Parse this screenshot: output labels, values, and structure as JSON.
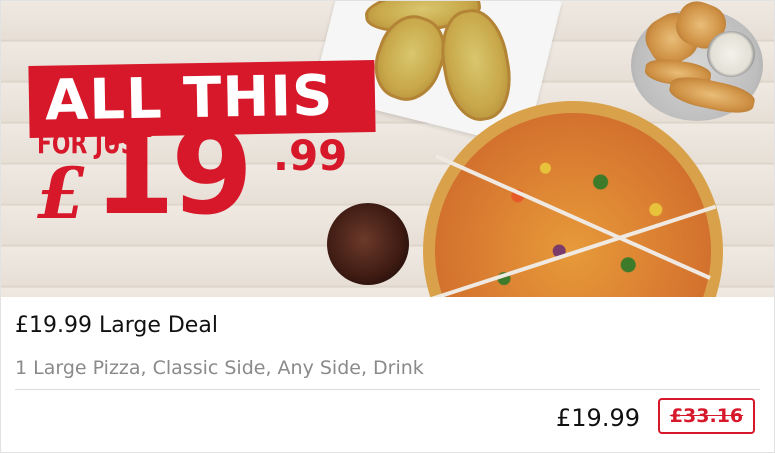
{
  "banner": {
    "headline": "ALL THIS",
    "for_just": "FOR JUST",
    "currency_symbol": "£",
    "price_whole": "19",
    "price_pennies": ".99",
    "brand_red": "#d7182a"
  },
  "deal": {
    "title": "£19.99 Large Deal",
    "description": "1 Large Pizza, Classic Side, Any Side, Drink",
    "price": "£19.99",
    "was_price": "£33.16"
  }
}
